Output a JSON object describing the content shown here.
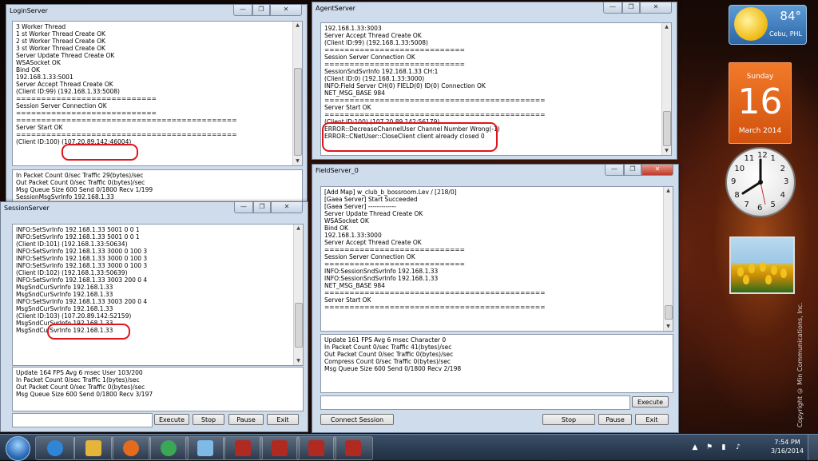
{
  "login": {
    "title": "LoginServer",
    "log": [
      "3 Worker Thread",
      "1 st Worker Thread Create OK",
      "2 st Worker Thread Create OK",
      "3 st Worker Thread Create OK",
      "Server Update Thread Create OK",
      "WSASocket OK",
      "Bind OK",
      "192.168.1.33:5001",
      "Server Accept Thread Create OK",
      "(Client ID:99) (192.168.1.33:5008)",
      "============================",
      "Session Server Connection OK",
      "============================",
      "============================================",
      "Server Start OK",
      "============================================",
      "(Client ID:100) (107.20.89.142:46004)"
    ],
    "stats": [
      "In Packet Count 0/sec Traffic 29(bytes)/sec",
      "Out Packet Count 0/sec Traffic 0(bytes)/sec",
      "Msg Queue Size 600 Send 0/1800 Recv 1/199",
      "SessionMsgSvrInfo 192.168.1.33"
    ]
  },
  "session": {
    "title": "SessionServer",
    "log": [
      "INFO:SetSvrInfo 192.168.1.33 5001 0 0 1",
      "INFO:SetSvrInfo 192.168.1.33 5001 0 0 1",
      "(Client ID:101) (192.168.1.33:50634)",
      "INFO:SetSvrInfo 192.168.1.33 3000 0 100 3",
      "INFO:SetSvrInfo 192.168.1.33 3000 0 100 3",
      "INFO:SetSvrInfo 192.168.1.33 3000 0 100 3",
      "(Client ID:102) (192.168.1.33:50639)",
      "INFO:SetSvrInfo 192.168.1.33 3003 200 0 4",
      "MsgSndCurSvrInfo 192.168.1.33",
      "MsgSndCurSvrInfo 192.168.1.33",
      "INFO:SetSvrInfo 192.168.1.33 3003 200 0 4",
      "MsgSndCurSvrInfo 192.168.1.33",
      "(Client ID:103) (107.20.89.142:52159)",
      "MsgSndCurSvrInfo 192.168.1.33",
      "MsgSndCurSvrInfo 192.168.1.33"
    ],
    "stats": [
      "Update 164 FPS Avg 6 msec User 103/200",
      "In Packet Count 0/sec Traffic 1(bytes)/sec",
      "Out Packet Count 0/sec Traffic 0(bytes)/sec",
      "Msg Queue Size 600 Send 0/1800 Recv 3/197"
    ],
    "buttons": {
      "execute": "Execute",
      "stop": "Stop",
      "pause": "Pause",
      "exit": "Exit"
    }
  },
  "agent": {
    "title": "AgentServer",
    "log": [
      "192.168.1.33:3003",
      "Server Accept Thread Create OK",
      "(Client ID:99) (192.168.1.33:5008)",
      "============================",
      "Session Server Connection OK",
      "============================",
      "SessionSndSvrInfo 192.168.1.33 CH:1",
      "(Client ID:0) (192.168.1.33:3000)",
      "INFO:Field Server CH(0) FIELD(0) ID(0) Connection OK",
      "NET_MSG_BASE 984",
      "============================================",
      "Server Start OK",
      "============================================",
      "(Client ID:100) (107.20.89.142:56179)",
      "ERROR::DecreaseChannelUser Channel Number Wrong(-1)",
      "ERROR::CNetUser::CloseClient client already closed 0"
    ]
  },
  "field": {
    "title": "FieldServer_0",
    "log": [
      "[Add Map] w_club_b_bossroom.Lev / [218/0]",
      "[Gaea Server] Start Succeeded",
      "[Gaea Server] -------------",
      "Server Update Thread Create OK",
      "WSASocket OK",
      "Bind OK",
      "192.168.1.33:3000",
      "Server Accept Thread Create OK",
      "============================",
      "Session Server Connection OK",
      "============================",
      "INFO:SessionSndSvrInfo 192.168.1.33",
      "INFO:SessionSndSvrInfo 192.168.1.33",
      "NET_MSG_BASE 984",
      "============================================",
      "Server Start OK",
      "============================================"
    ],
    "stats": [
      "Update 161 FPS Avg 6 msec Character 0",
      "In Packet Count 0/sec Traffic 41(bytes)/sec",
      "Out Packet Count 0/sec Traffic 0(bytes)/sec",
      "Compress Count 0/sec Traffic 0(bytes)/sec",
      "Msg Queue Size 600 Send 0/1800 Recv 2/198"
    ],
    "buttons": {
      "execute": "Execute",
      "connect": "Connect Session",
      "stop": "Stop",
      "pause": "Pause",
      "exit": "Exit"
    }
  },
  "widgets": {
    "weather": {
      "temp": "84°",
      "city": "Cebu, PHL"
    },
    "calendar": {
      "dow": "Sunday",
      "day": "16",
      "month_year": "March 2014"
    },
    "clock_numbers": [
      "12",
      "1",
      "2",
      "3",
      "4",
      "5",
      "6",
      "7",
      "8",
      "9",
      "10",
      "11"
    ]
  },
  "desktop": {
    "copyright": "Copyright © Min Communications, Inc."
  },
  "taskbar": {
    "time": "7:54 PM",
    "date": "3/16/2014",
    "items": [
      "windows-explorer-icon",
      "internet-explorer-icon",
      "file-explorer-icon",
      "firefox-icon",
      "chrome-icon",
      "notepad-icon",
      "server-app-icon",
      "server-app-icon",
      "server-app-icon",
      "server-app-icon"
    ]
  },
  "colors": {
    "highlight": "#e0141b",
    "window_frame": "#cfdcec"
  }
}
